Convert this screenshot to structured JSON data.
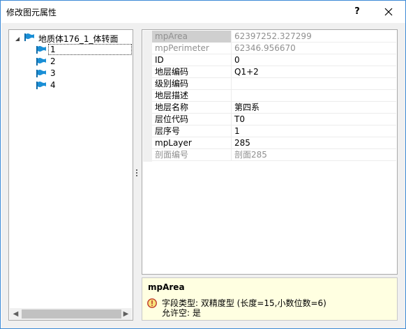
{
  "window": {
    "title": "修改图元属性",
    "help_label": "?",
    "close_icon": "close-icon"
  },
  "tree": {
    "root": {
      "label": "地质体176_1_体转面",
      "expanded": true,
      "icon": "flag-icon"
    },
    "children": [
      {
        "label": "1",
        "icon": "flag-icon",
        "selected": true
      },
      {
        "label": "2",
        "icon": "flag-icon",
        "selected": false
      },
      {
        "label": "3",
        "icon": "flag-icon",
        "selected": false
      },
      {
        "label": "4",
        "icon": "flag-icon",
        "selected": false
      }
    ]
  },
  "properties": [
    {
      "name": "mpArea",
      "value": "62397252.327299",
      "readonly": true
    },
    {
      "name": "mpPerimeter",
      "value": "62346.956670",
      "readonly": true
    },
    {
      "name": "ID",
      "value": "0",
      "readonly": false
    },
    {
      "name": "地层编码",
      "value": "Q1+2",
      "readonly": false
    },
    {
      "name": "级别编码",
      "value": "",
      "readonly": false
    },
    {
      "name": "地层描述",
      "value": "",
      "readonly": false
    },
    {
      "name": "地层名称",
      "value": "第四系",
      "readonly": false
    },
    {
      "name": "层位代码",
      "value": "T0",
      "readonly": false
    },
    {
      "name": "层序号",
      "value": "1",
      "readonly": false
    },
    {
      "name": "mpLayer",
      "value": "285",
      "readonly": false
    },
    {
      "name": "剖面编号",
      "value": "剖面285",
      "readonly": true
    }
  ],
  "help": {
    "title": "mpArea",
    "icon": "warning-icon",
    "line1": "字段类型: 双精度型 (长度=15,小数位数=6)",
    "line2": "允许空: 是"
  },
  "colors": {
    "accent_border": "#3c8ad6",
    "flag_blue": "#1a8fd6",
    "help_background": "#ffffe1"
  }
}
